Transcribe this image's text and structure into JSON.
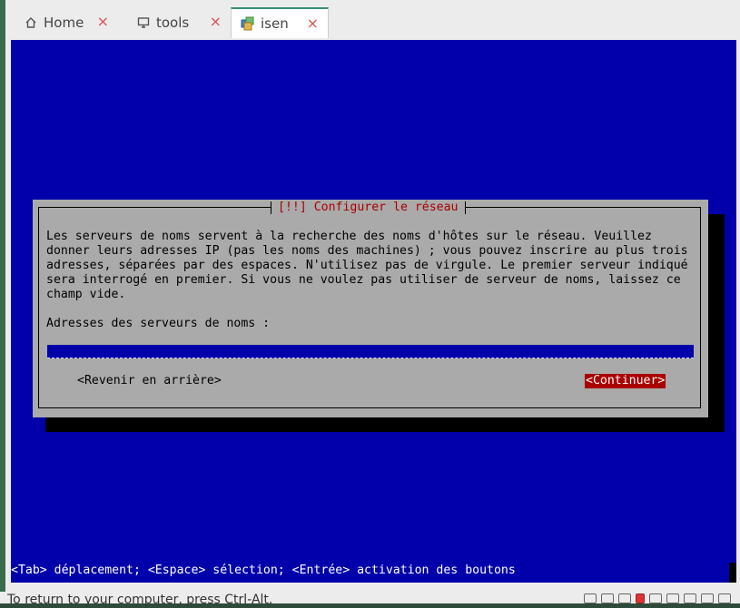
{
  "tabs": [
    {
      "label": "Home",
      "icon": "home-icon"
    },
    {
      "label": "tools",
      "icon": "monitor-icon"
    },
    {
      "label": "isen",
      "icon": "vm-icon",
      "active": true
    }
  ],
  "dialog": {
    "title": "[!!] Configurer le réseau",
    "lines": [
      "Les serveurs de noms servent à la recherche des noms d'hôtes sur le réseau. Veuillez",
      "donner leurs adresses IP (pas les noms des machines) ; vous pouvez inscrire au plus trois",
      "adresses, séparées par des espaces. N'utilisez pas de virgule. Le premier serveur indiqué",
      "sera interrogé en premier. Si vous ne voulez pas utiliser de serveur de noms, laissez ce",
      "champ vide."
    ],
    "field_label": "Adresses des serveurs de noms :",
    "field_value": "",
    "back_button": "<Revenir en arrière>",
    "continue_button": "<Continuer>"
  },
  "hint": "<Tab> déplacement; <Espace> sélection; <Entrée> activation des boutons",
  "status_text": "To return to your computer, press Ctrl-Alt.",
  "colors": {
    "screen": "#0000aa",
    "dialog": "#aaaaaa",
    "accent_red": "#aa0000",
    "tab_accent": "#3b8f73"
  }
}
